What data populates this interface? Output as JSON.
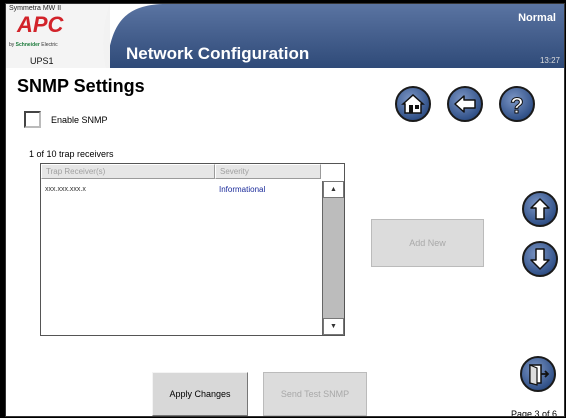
{
  "header": {
    "product_name": "Symmetra MW II",
    "logo_text": "APC",
    "logo_sub_prefix": "by",
    "logo_sub_brand": "Schneider",
    "logo_sub_suffix": "Electric",
    "device_label": "UPS1",
    "title": "Network Configuration",
    "status": "Normal",
    "time": "13:27"
  },
  "main": {
    "heading": "SNMP Settings",
    "enable_snmp": {
      "label": "Enable SNMP",
      "checked": false
    },
    "receiver_count": "1 of 10 trap receivers",
    "table": {
      "columns": [
        "Trap Receiver(s)",
        "Severity"
      ],
      "rows": [
        {
          "receiver": "xxx.xxx.xxx.x",
          "severity": "Informational"
        }
      ]
    }
  },
  "buttons": {
    "add_new": "Add New",
    "apply_changes": "Apply Changes",
    "send_test": "Send Test SNMP"
  },
  "icons": {
    "home": "home-icon",
    "back": "back-arrow-icon",
    "help": "help-icon",
    "up": "up-arrow-icon",
    "down": "down-arrow-icon",
    "exit": "exit-door-icon"
  },
  "footer": {
    "page_indicator": "Page 3 of 6"
  },
  "colors": {
    "header_blue": "#34507f",
    "logo_red": "#d2232a",
    "severity_text": "#1a2a9a"
  }
}
